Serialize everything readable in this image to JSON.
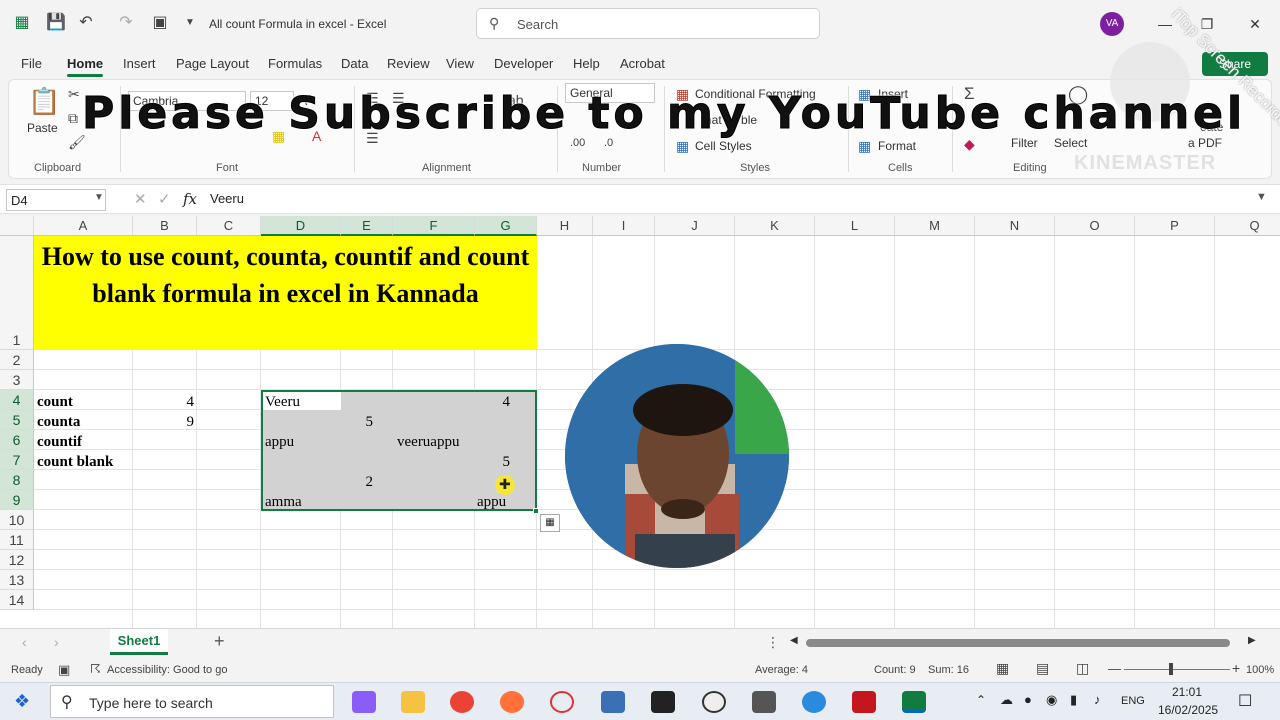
{
  "titlebar": {
    "doc_title": "All count Formula in excel  -  Excel",
    "search_placeholder": "Search",
    "user_initials": "VA"
  },
  "menu": [
    "File",
    "Home",
    "Insert",
    "Page Layout",
    "Formulas",
    "Data",
    "Review",
    "View",
    "Developer",
    "Help",
    "Acrobat"
  ],
  "ribbon": {
    "paste_label": "Paste",
    "font_name": "Cambria",
    "font_size": "12",
    "number_format": "General",
    "conditional_formatting": "Conditional Formatting",
    "format_as_table": "nat as  ble",
    "cell_styles": "Cell Styles",
    "insert": "Insert",
    "format": "Format",
    "filter": "Filter",
    "select": "Select",
    "create_pdf_1": "eate",
    "create_pdf_2": "a PDF",
    "share": "Share",
    "groups": [
      "Clipboard",
      "Font",
      "Alignment",
      "Number",
      "Styles",
      "Cells",
      "Editing"
    ]
  },
  "overlay_text": "Please Subscribe to my YouTube channel",
  "watermarks": {
    "itop": "iTop Screen Recorder",
    "kinemaster": "KINEMASTER"
  },
  "formula_bar": {
    "name_box": "D4",
    "fx": "fx",
    "content": "Veeru"
  },
  "columns": [
    "A",
    "B",
    "C",
    "D",
    "E",
    "F",
    "G",
    "H",
    "I",
    "J",
    "K",
    "L",
    "M",
    "N",
    "O",
    "P",
    "Q"
  ],
  "rows": [
    "1",
    "2",
    "3",
    "4",
    "5",
    "6",
    "7",
    "8",
    "9",
    "10",
    "11",
    "12",
    "13",
    "14"
  ],
  "sheet": {
    "title": "How to use count, counta, countif and count blank formula in excel in Kannada",
    "labels": [
      "count",
      "counta",
      "countif",
      "count blank"
    ],
    "values": [
      "4",
      "9"
    ],
    "d4": "Veeru",
    "g4": "4",
    "e5": "5",
    "d6": "appu",
    "f6": "veeruappu",
    "g7": "5",
    "e8": "2",
    "d9": "amma",
    "g9": "appu"
  },
  "tabs": {
    "sheet1": "Sheet1",
    "add": "+"
  },
  "status": {
    "ready": "Ready",
    "accessibility": "Accessibility: Good to go",
    "average": "Average: 4",
    "count": "Count: 9",
    "sum": "Sum: 16",
    "zoom": "100%"
  },
  "taskbar": {
    "search_placeholder": "Type here to search",
    "lang": "ENG",
    "time": "21:01",
    "date": "16/02/2025"
  },
  "colors": {
    "excel_green": "#107c41",
    "title_fill": "#ffff00",
    "selection_gray": "#d2d2d2"
  }
}
